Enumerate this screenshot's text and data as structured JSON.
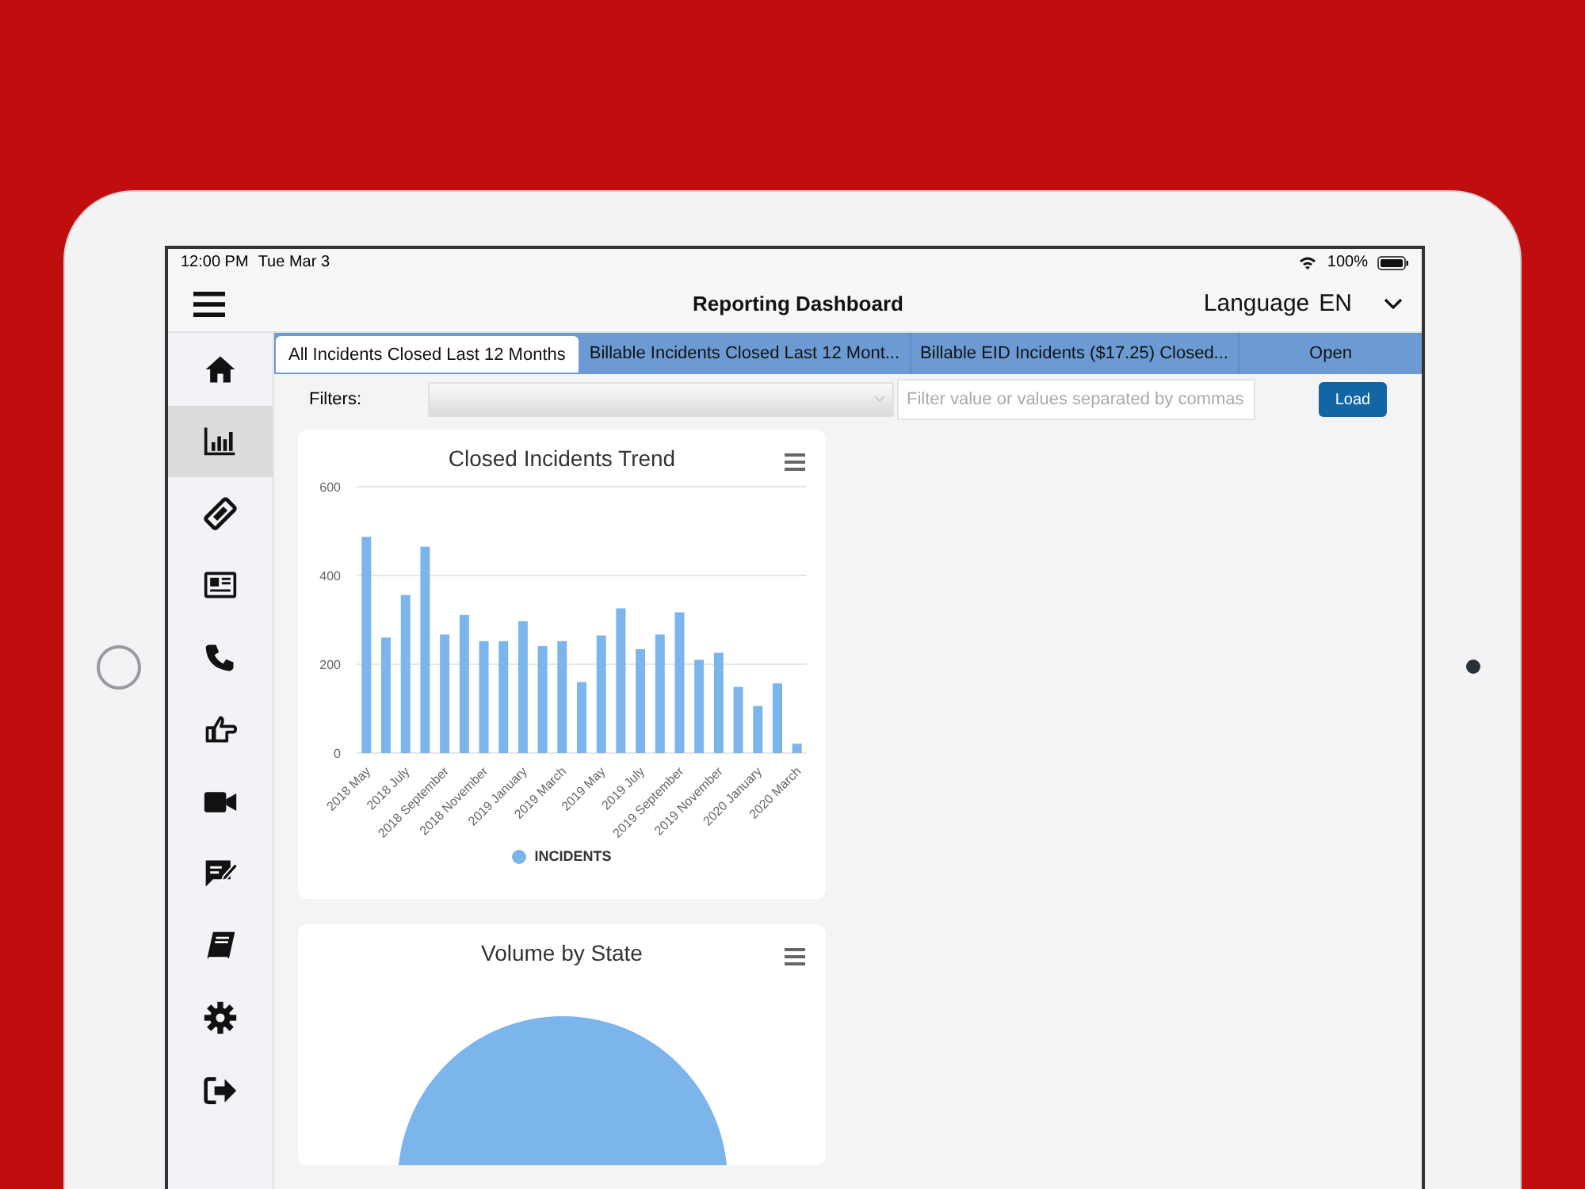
{
  "status_bar": {
    "time": "12:00 PM",
    "date": "Tue Mar 3",
    "battery": "100%"
  },
  "header": {
    "title": "Reporting Dashboard",
    "language_label": "Language",
    "language_value": "EN"
  },
  "sidebar": {
    "items": [
      {
        "kind": "home",
        "selected": false
      },
      {
        "kind": "chart",
        "selected": true
      },
      {
        "kind": "ticket",
        "selected": false
      },
      {
        "kind": "news",
        "selected": false
      },
      {
        "kind": "phone",
        "selected": false
      },
      {
        "kind": "thumb",
        "selected": false
      },
      {
        "kind": "video",
        "selected": false
      },
      {
        "kind": "comment",
        "selected": false
      },
      {
        "kind": "book",
        "selected": false
      },
      {
        "kind": "gear",
        "selected": false
      },
      {
        "kind": "logout",
        "selected": false
      }
    ]
  },
  "tabs": [
    {
      "label": "All Incidents Closed Last 12 Months",
      "selected": true
    },
    {
      "label": "Billable Incidents Closed Last 12 Mont...",
      "selected": false
    },
    {
      "label": "Billable EID Incidents ($17.25) Closed...",
      "selected": false
    },
    {
      "label": "Open",
      "selected": false
    }
  ],
  "filters": {
    "label": "Filters:",
    "placeholder": "Filter value or values separated by commas",
    "button": "Load"
  },
  "cards": [
    {
      "kind": "bar",
      "title": "Closed Incidents Trend",
      "chart_data": {
        "type": "bar",
        "categories": [
          "2018 May",
          null,
          "2018 July",
          null,
          "2018 September",
          null,
          "2018 November",
          null,
          "2019 January",
          null,
          "2019 March",
          null,
          "2019 May",
          null,
          "2019 July",
          null,
          "2019 September",
          null,
          "2019 November",
          null,
          "2020 January",
          null,
          "2020 March"
        ],
        "series": [
          {
            "name": "INCIDENTS",
            "color": "#7cb5ec",
            "values": [
              487,
              260,
              356,
              465,
              267,
              311,
              252,
              252,
              297,
              241,
              252,
              160,
              265,
              326,
              234,
              267,
              317,
              210,
              226,
              149,
              106,
              157,
              21
            ]
          }
        ],
        "ylim": [
          0,
          600
        ],
        "yticks": [
          0,
          200,
          400,
          600
        ]
      }
    },
    {
      "kind": "pie",
      "title": "Volume by State"
    }
  ]
}
